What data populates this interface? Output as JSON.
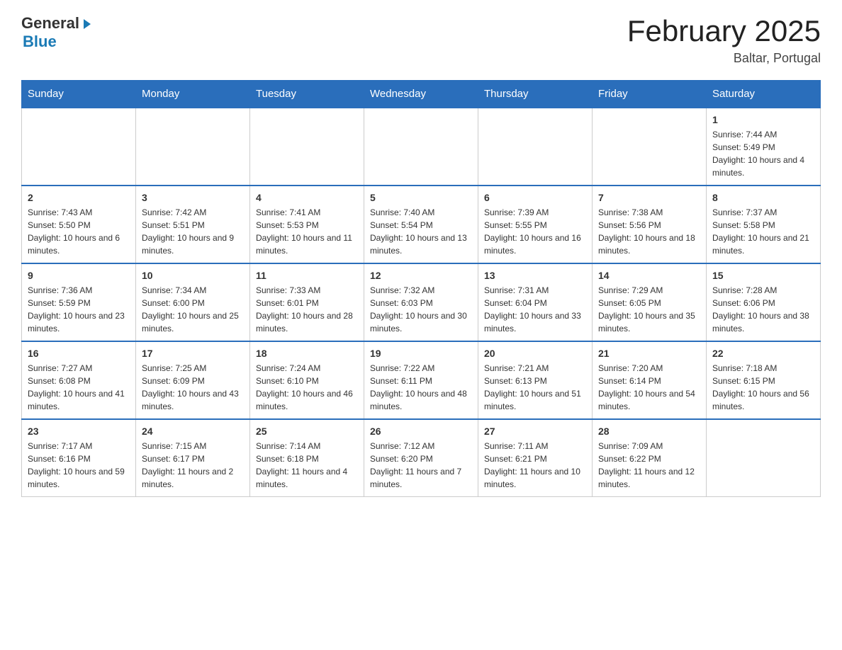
{
  "header": {
    "logo": {
      "general": "General",
      "arrow": "▶",
      "blue": "Blue"
    },
    "title": "February 2025",
    "location": "Baltar, Portugal"
  },
  "weekdays": [
    "Sunday",
    "Monday",
    "Tuesday",
    "Wednesday",
    "Thursday",
    "Friday",
    "Saturday"
  ],
  "weeks": [
    [
      {
        "day": "",
        "info": ""
      },
      {
        "day": "",
        "info": ""
      },
      {
        "day": "",
        "info": ""
      },
      {
        "day": "",
        "info": ""
      },
      {
        "day": "",
        "info": ""
      },
      {
        "day": "",
        "info": ""
      },
      {
        "day": "1",
        "info": "Sunrise: 7:44 AM\nSunset: 5:49 PM\nDaylight: 10 hours and 4 minutes."
      }
    ],
    [
      {
        "day": "2",
        "info": "Sunrise: 7:43 AM\nSunset: 5:50 PM\nDaylight: 10 hours and 6 minutes."
      },
      {
        "day": "3",
        "info": "Sunrise: 7:42 AM\nSunset: 5:51 PM\nDaylight: 10 hours and 9 minutes."
      },
      {
        "day": "4",
        "info": "Sunrise: 7:41 AM\nSunset: 5:53 PM\nDaylight: 10 hours and 11 minutes."
      },
      {
        "day": "5",
        "info": "Sunrise: 7:40 AM\nSunset: 5:54 PM\nDaylight: 10 hours and 13 minutes."
      },
      {
        "day": "6",
        "info": "Sunrise: 7:39 AM\nSunset: 5:55 PM\nDaylight: 10 hours and 16 minutes."
      },
      {
        "day": "7",
        "info": "Sunrise: 7:38 AM\nSunset: 5:56 PM\nDaylight: 10 hours and 18 minutes."
      },
      {
        "day": "8",
        "info": "Sunrise: 7:37 AM\nSunset: 5:58 PM\nDaylight: 10 hours and 21 minutes."
      }
    ],
    [
      {
        "day": "9",
        "info": "Sunrise: 7:36 AM\nSunset: 5:59 PM\nDaylight: 10 hours and 23 minutes."
      },
      {
        "day": "10",
        "info": "Sunrise: 7:34 AM\nSunset: 6:00 PM\nDaylight: 10 hours and 25 minutes."
      },
      {
        "day": "11",
        "info": "Sunrise: 7:33 AM\nSunset: 6:01 PM\nDaylight: 10 hours and 28 minutes."
      },
      {
        "day": "12",
        "info": "Sunrise: 7:32 AM\nSunset: 6:03 PM\nDaylight: 10 hours and 30 minutes."
      },
      {
        "day": "13",
        "info": "Sunrise: 7:31 AM\nSunset: 6:04 PM\nDaylight: 10 hours and 33 minutes."
      },
      {
        "day": "14",
        "info": "Sunrise: 7:29 AM\nSunset: 6:05 PM\nDaylight: 10 hours and 35 minutes."
      },
      {
        "day": "15",
        "info": "Sunrise: 7:28 AM\nSunset: 6:06 PM\nDaylight: 10 hours and 38 minutes."
      }
    ],
    [
      {
        "day": "16",
        "info": "Sunrise: 7:27 AM\nSunset: 6:08 PM\nDaylight: 10 hours and 41 minutes."
      },
      {
        "day": "17",
        "info": "Sunrise: 7:25 AM\nSunset: 6:09 PM\nDaylight: 10 hours and 43 minutes."
      },
      {
        "day": "18",
        "info": "Sunrise: 7:24 AM\nSunset: 6:10 PM\nDaylight: 10 hours and 46 minutes."
      },
      {
        "day": "19",
        "info": "Sunrise: 7:22 AM\nSunset: 6:11 PM\nDaylight: 10 hours and 48 minutes."
      },
      {
        "day": "20",
        "info": "Sunrise: 7:21 AM\nSunset: 6:13 PM\nDaylight: 10 hours and 51 minutes."
      },
      {
        "day": "21",
        "info": "Sunrise: 7:20 AM\nSunset: 6:14 PM\nDaylight: 10 hours and 54 minutes."
      },
      {
        "day": "22",
        "info": "Sunrise: 7:18 AM\nSunset: 6:15 PM\nDaylight: 10 hours and 56 minutes."
      }
    ],
    [
      {
        "day": "23",
        "info": "Sunrise: 7:17 AM\nSunset: 6:16 PM\nDaylight: 10 hours and 59 minutes."
      },
      {
        "day": "24",
        "info": "Sunrise: 7:15 AM\nSunset: 6:17 PM\nDaylight: 11 hours and 2 minutes."
      },
      {
        "day": "25",
        "info": "Sunrise: 7:14 AM\nSunset: 6:18 PM\nDaylight: 11 hours and 4 minutes."
      },
      {
        "day": "26",
        "info": "Sunrise: 7:12 AM\nSunset: 6:20 PM\nDaylight: 11 hours and 7 minutes."
      },
      {
        "day": "27",
        "info": "Sunrise: 7:11 AM\nSunset: 6:21 PM\nDaylight: 11 hours and 10 minutes."
      },
      {
        "day": "28",
        "info": "Sunrise: 7:09 AM\nSunset: 6:22 PM\nDaylight: 11 hours and 12 minutes."
      },
      {
        "day": "",
        "info": ""
      }
    ]
  ]
}
